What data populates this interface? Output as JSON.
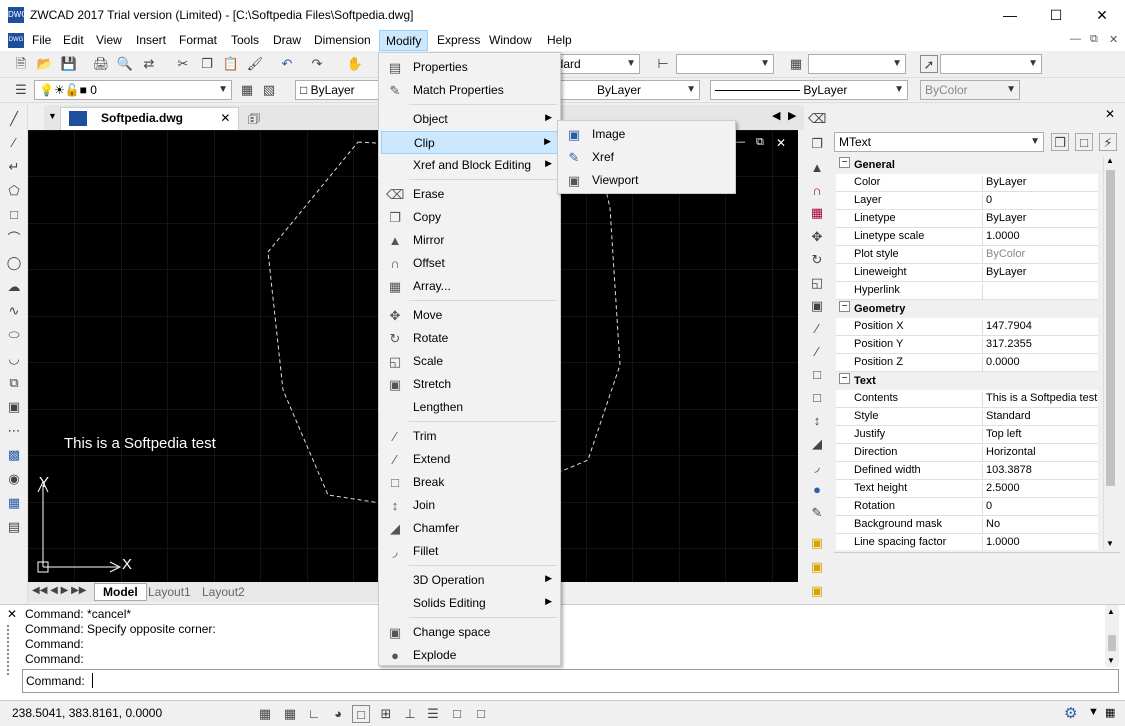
{
  "window": {
    "title": "ZWCAD 2017 Trial version (Limited) - [C:\\Softpedia Files\\Softpedia.dwg]",
    "app_icon": "DWG"
  },
  "menubar": {
    "items": [
      "File",
      "Edit",
      "View",
      "Insert",
      "Format",
      "Tools",
      "Draw",
      "Dimension",
      "Modify",
      "Express",
      "Window",
      "Help"
    ],
    "active": "Modify"
  },
  "toolbar": {
    "layer_value": "0",
    "color_value": "ByLayer",
    "linetype_value": "ByLayer",
    "lineweight_value": "ByLayer",
    "plotstyle_value": "ByColor",
    "textstyle_value": "ndard"
  },
  "document": {
    "tab_label": "Softpedia.dwg",
    "canvas_text": "This is a Softpedia test",
    "axis_x": "X",
    "axis_y": "Y"
  },
  "layout_tabs": [
    "Model",
    "Layout1",
    "Layout2"
  ],
  "modify_menu": {
    "items": [
      {
        "label": "Properties",
        "icon": "properties-icon",
        "sub": false
      },
      {
        "label": "Match Properties",
        "icon": "brush-icon",
        "sub": false
      },
      {
        "label": "Object",
        "icon": "",
        "sub": true
      },
      {
        "label": "Clip",
        "icon": "",
        "sub": true,
        "highlight": true
      },
      {
        "label": "Xref and Block Editing",
        "icon": "",
        "sub": true
      },
      {
        "label": "Erase",
        "icon": "eraser-icon",
        "sub": false
      },
      {
        "label": "Copy",
        "icon": "copy-icon",
        "sub": false
      },
      {
        "label": "Mirror",
        "icon": "mirror-icon",
        "sub": false
      },
      {
        "label": "Offset",
        "icon": "offset-icon",
        "sub": false
      },
      {
        "label": "Array...",
        "icon": "array-icon",
        "sub": false
      },
      {
        "label": "Move",
        "icon": "move-icon",
        "sub": false
      },
      {
        "label": "Rotate",
        "icon": "rotate-icon",
        "sub": false
      },
      {
        "label": "Scale",
        "icon": "scale-icon",
        "sub": false
      },
      {
        "label": "Stretch",
        "icon": "stretch-icon",
        "sub": false
      },
      {
        "label": "Lengthen",
        "icon": "",
        "sub": false
      },
      {
        "label": "Trim",
        "icon": "trim-icon",
        "sub": false
      },
      {
        "label": "Extend",
        "icon": "extend-icon",
        "sub": false
      },
      {
        "label": "Break",
        "icon": "break-icon",
        "sub": false
      },
      {
        "label": "Join",
        "icon": "join-icon",
        "sub": false
      },
      {
        "label": "Chamfer",
        "icon": "chamfer-icon",
        "sub": false
      },
      {
        "label": "Fillet",
        "icon": "fillet-icon",
        "sub": false
      },
      {
        "label": "3D Operation",
        "icon": "",
        "sub": true
      },
      {
        "label": "Solids Editing",
        "icon": "",
        "sub": true
      },
      {
        "label": "Change space",
        "icon": "change-space-icon",
        "sub": false
      },
      {
        "label": "Explode",
        "icon": "explode-icon",
        "sub": false
      }
    ]
  },
  "clip_submenu": {
    "items": [
      "Image",
      "Xref",
      "Viewport"
    ]
  },
  "properties_panel": {
    "object_type": "MText",
    "sections": [
      {
        "title": "General",
        "rows": [
          [
            "Color",
            "ByLayer"
          ],
          [
            "Layer",
            "0"
          ],
          [
            "Linetype",
            "ByLayer"
          ],
          [
            "Linetype scale",
            "1.0000"
          ],
          [
            "Plot style",
            "ByColor"
          ],
          [
            "Lineweight",
            "ByLayer"
          ],
          [
            "Hyperlink",
            ""
          ]
        ]
      },
      {
        "title": "Geometry",
        "rows": [
          [
            "Position X",
            "147.7904"
          ],
          [
            "Position Y",
            "317.2355"
          ],
          [
            "Position Z",
            "0.0000"
          ]
        ]
      },
      {
        "title": "Text",
        "rows": [
          [
            "Contents",
            "This is a Softpedia test"
          ],
          [
            "Style",
            "Standard"
          ],
          [
            "Justify",
            "Top left"
          ],
          [
            "Direction",
            "Horizontal"
          ],
          [
            "Defined width",
            "103.3878"
          ],
          [
            "Text height",
            "2.5000"
          ],
          [
            "Rotation",
            "0"
          ],
          [
            "Background mask",
            "No"
          ],
          [
            "Line spacing factor",
            "1.0000"
          ]
        ]
      }
    ]
  },
  "command_history": [
    "Command: *cancel*",
    "Command: Specify opposite corner:",
    "Command:",
    "Command:"
  ],
  "command_prompt": "Command:",
  "status": {
    "coordinates": "238.5041, 383.8161, 0.0000"
  }
}
